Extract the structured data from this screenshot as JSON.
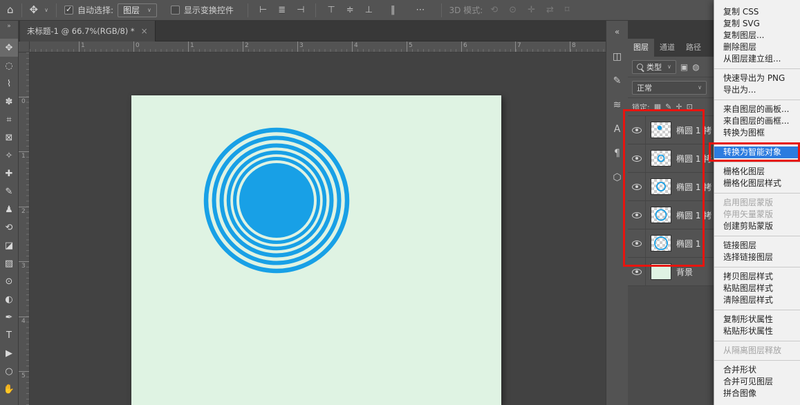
{
  "theme": {
    "accent_blue": "#2c7cdf",
    "shape_blue": "#18a0e6",
    "canvas_mint": "#dff3e3",
    "panel_gray": "#535353",
    "annotation_red": "#e8140f"
  },
  "glyphs": {
    "chevron": "∨"
  },
  "options_bar": {
    "home_glyph": "⌂",
    "move_glyph": "✥",
    "auto_select_label": "自动选择:",
    "target_value": "图层",
    "show_transform_label": "显示变换控件",
    "align_icons": [
      {
        "name": "align-left-icon",
        "glyph": "⊢"
      },
      {
        "name": "align-center-h-icon",
        "glyph": "≣"
      },
      {
        "name": "align-right-icon",
        "glyph": "⊣"
      },
      {
        "name": "align-top-icon",
        "glyph": "⊤"
      },
      {
        "name": "distribute-vertical-icon",
        "glyph": "≑"
      },
      {
        "name": "align-bottom-icon",
        "glyph": "⊥"
      },
      {
        "name": "distribute-horizontal-icon",
        "glyph": "‖"
      },
      {
        "name": "more-align-options-icon",
        "glyph": "⋯"
      }
    ],
    "mode_3d_label": "3D 模式:",
    "threed_icons": [
      {
        "name": "3d-orbit-icon",
        "glyph": "⟲"
      },
      {
        "name": "3d-roll-icon",
        "glyph": "⊙"
      },
      {
        "name": "3d-pan-icon",
        "glyph": "✛"
      },
      {
        "name": "3d-slide-icon",
        "glyph": "⇄"
      },
      {
        "name": "3d-camera-icon",
        "glyph": "⌑"
      }
    ]
  },
  "tools_strip": {
    "collapse_glyph": "»"
  },
  "tools": [
    {
      "name": "move-tool",
      "glyph": "✥"
    },
    {
      "name": "elliptical-marquee-tool",
      "glyph": "◌"
    },
    {
      "name": "lasso-tool",
      "glyph": "⌇"
    },
    {
      "name": "quick-selection-tool",
      "glyph": "✽"
    },
    {
      "name": "crop-tool",
      "glyph": "⌗"
    },
    {
      "name": "frame-tool",
      "glyph": "⊠"
    },
    {
      "name": "eyedropper-tool",
      "glyph": "✧"
    },
    {
      "name": "healing-brush-tool",
      "glyph": "✚"
    },
    {
      "name": "brush-tool",
      "glyph": "✎"
    },
    {
      "name": "clone-stamp-tool",
      "glyph": "♟"
    },
    {
      "name": "history-brush-tool",
      "glyph": "⟲"
    },
    {
      "name": "eraser-tool",
      "glyph": "◪"
    },
    {
      "name": "gradient-tool",
      "glyph": "▨"
    },
    {
      "name": "blur-tool",
      "glyph": "⊙"
    },
    {
      "name": "dodge-tool",
      "glyph": "◐"
    },
    {
      "name": "pen-tool",
      "glyph": "✒"
    },
    {
      "name": "type-tool",
      "glyph": "T"
    },
    {
      "name": "path-selection-tool",
      "glyph": "▶"
    },
    {
      "name": "ellipse-tool",
      "glyph": "○"
    },
    {
      "name": "hand-tool",
      "glyph": "✋"
    }
  ],
  "document_tab": {
    "title": "未标题-1 @ 66.7%(RGB/8) *",
    "close": "×"
  },
  "ruler": {
    "horizontal": [
      "1",
      "0",
      "1",
      "2",
      "3",
      "4",
      "5",
      "6",
      "7",
      "8"
    ],
    "vertical": [
      "0",
      "1",
      "2",
      "3",
      "4",
      "5"
    ]
  },
  "dock": {
    "collapse_glyph": "«",
    "icons": [
      {
        "name": "properties-panel-icon",
        "glyph": "◫"
      },
      {
        "name": "brush-settings-panel-icon",
        "glyph": "✎"
      },
      {
        "name": "clone-source-panel-icon",
        "glyph": "≋"
      },
      {
        "name": "character-panel-icon",
        "glyph": "A"
      },
      {
        "name": "paragraph-panel-icon",
        "glyph": "¶"
      },
      {
        "name": "3d-panel-icon",
        "glyph": "⬡"
      }
    ]
  },
  "layers_panel": {
    "tabs": [
      {
        "label": "图层"
      },
      {
        "label": "通道"
      },
      {
        "label": "路径"
      }
    ],
    "filter_type_value": "类型",
    "filter_icons": [
      {
        "name": "filter-pixel-layer-icon",
        "glyph": "▣"
      },
      {
        "name": "filter-adjustment-layer-icon",
        "glyph": "◍"
      }
    ],
    "blend_mode_value": "正常",
    "lock_label": "锁定:",
    "lock_icons": [
      {
        "name": "lock-transparent-pixels-icon",
        "glyph": "▦"
      },
      {
        "name": "lock-paint-icon",
        "glyph": "✎"
      },
      {
        "name": "lock-position-icon",
        "glyph": "✛"
      },
      {
        "name": "lock-artboard-icon",
        "glyph": "⊡"
      }
    ],
    "layers": [
      {
        "name": "椭圆 1 拷"
      },
      {
        "name": "椭圆 1 拷"
      },
      {
        "name": "椭圆 1 拷"
      },
      {
        "name": "椭圆 1 拷"
      },
      {
        "name": "椭圆 1"
      },
      {
        "name": "背景"
      }
    ]
  },
  "context_menu": {
    "items": [
      {
        "label": "复制 CSS"
      },
      {
        "label": "复制 SVG"
      },
      {
        "label": "复制图层..."
      },
      {
        "label": "删除图层"
      },
      {
        "label": "从图层建立组..."
      },
      {
        "label": "快速导出为 PNG"
      },
      {
        "label": "导出为..."
      },
      {
        "label": "来自图层的画板..."
      },
      {
        "label": "来自图层的画框..."
      },
      {
        "label": "转换为图框"
      },
      {
        "label": "转换为智能对象"
      },
      {
        "label": "栅格化图层"
      },
      {
        "label": "栅格化图层样式"
      },
      {
        "label": "启用图层蒙版"
      },
      {
        "label": "停用矢量蒙版"
      },
      {
        "label": "创建剪贴蒙版"
      },
      {
        "label": "链接图层"
      },
      {
        "label": "选择链接图层"
      },
      {
        "label": "拷贝图层样式"
      },
      {
        "label": "粘贴图层样式"
      },
      {
        "label": "清除图层样式"
      },
      {
        "label": "复制形状属性"
      },
      {
        "label": "粘贴形状属性"
      },
      {
        "label": "从隔离图层释放"
      },
      {
        "label": "合并形状"
      },
      {
        "label": "合并可见图层"
      },
      {
        "label": "拼合图像"
      }
    ]
  }
}
